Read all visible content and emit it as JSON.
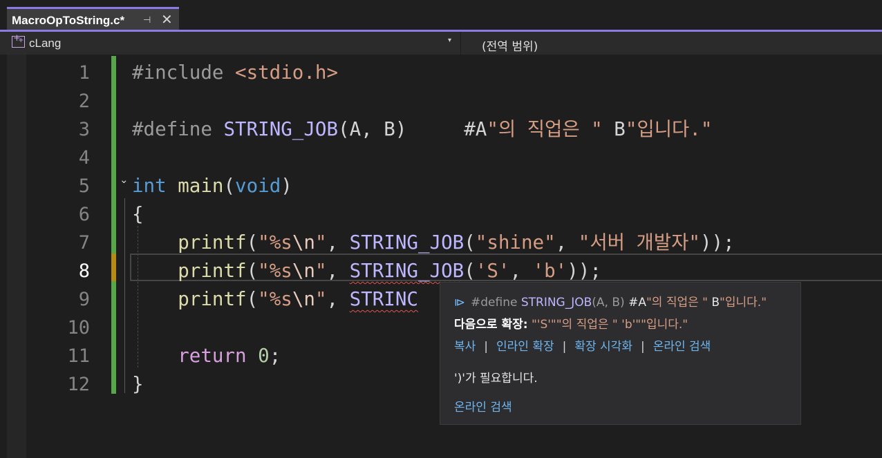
{
  "tab": {
    "title": "MacroOpToString.c*",
    "pin_glyph": "⊣",
    "close_glyph": "✕"
  },
  "navbar": {
    "project": "cLang",
    "dropdown_glyph": "▾",
    "scope": "(전역 범위)"
  },
  "editor": {
    "line_numbers": [
      "1",
      "2",
      "3",
      "4",
      "5",
      "6",
      "7",
      "8",
      "9",
      "10",
      "11",
      "12"
    ],
    "active_line": "8",
    "fold_glyph": "⌄",
    "lines": {
      "l1": {
        "include": "#include",
        "header": "<stdio.h>"
      },
      "l3": {
        "define": "#define",
        "macro": "STRING_JOB",
        "params": "(A, B)",
        "pad": "     ",
        "body_a": "#A",
        "body_str1": "\"의 직업은 \"",
        "body_b": " B",
        "body_str2": "\"입니다.\""
      },
      "l5": {
        "type": "int",
        "name": "main",
        "open": "(",
        "param": "void",
        "close": ")"
      },
      "l6": {
        "brace": "{"
      },
      "l7": {
        "indent": "    ",
        "fn": "printf",
        "p1": "(",
        "fmt_a": "\"%s",
        "fmt_esc": "\\n",
        "fmt_b": "\"",
        "comma": ", ",
        "macro": "STRING_JOB",
        "p2": "(",
        "arg1": "\"shine\"",
        "sep": ", ",
        "arg2": "\"서버 개발자\"",
        "end": "));"
      },
      "l8": {
        "indent": "    ",
        "fn": "printf",
        "p1": "(",
        "fmt_a": "\"%s",
        "fmt_esc": "\\n",
        "fmt_b": "\"",
        "comma": ", ",
        "macro": "STRING_JOB",
        "p2": "(",
        "arg1": "'S'",
        "sep": ", ",
        "arg2": "'b'",
        "end": "));"
      },
      "l9": {
        "indent": "    ",
        "fn": "printf",
        "p1": "(",
        "fmt_a": "\"%s",
        "fmt_esc": "\\n",
        "fmt_b": "\"",
        "comma": ", ",
        "macro": "STRINC"
      },
      "l11": {
        "indent": "    ",
        "kw": "return",
        "space": " ",
        "num": "0",
        "semi": ";"
      },
      "l12": {
        "brace": "}"
      }
    }
  },
  "tooltip": {
    "icon_glyph": "⧐",
    "def_prefix": "#define ",
    "def_macro": "STRING_JOB",
    "def_params": "(A, B) ",
    "def_a": "#A",
    "def_str1": "\"의 직업은 \"",
    "def_b": " B",
    "def_str2": "\"입니다.\"",
    "expand_label": "다음으로 확장:",
    "expand_value": " \"'S'\"\"의 직업은 \" 'b'\"\"입니다.\"",
    "actions": [
      "복사",
      "인라인 확장",
      "확장 시각화",
      "온라인 검색"
    ],
    "pipe": "|",
    "error": "')'가 필요합니다.",
    "search_link": "온라인 검색"
  },
  "colors": {
    "accent": "#8c7ae6",
    "keyword": "#569cd6",
    "function": "#dcdcaa",
    "macro": "#beb7ff",
    "string": "#d69d85",
    "number": "#b5cea8",
    "control": "#d8a0df",
    "change_saved": "#57a64a",
    "change_unsaved": "#b58b14",
    "link": "#6fb6f0",
    "error_squiggle": "#e05252"
  }
}
